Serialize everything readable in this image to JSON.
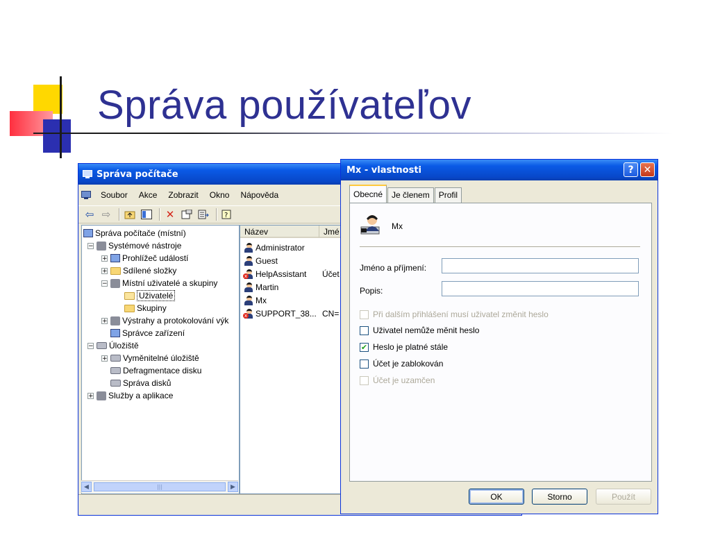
{
  "slide": {
    "title": "Správa používateľov"
  },
  "mmc": {
    "title": "Správa počítače",
    "menu": [
      "Soubor",
      "Akce",
      "Zobrazit",
      "Okno",
      "Nápověda"
    ],
    "tree": [
      {
        "label": "Správa počítače (místní)",
        "level": 0,
        "expander": "",
        "icon": "computer-icon"
      },
      {
        "label": "Systémové nástroje",
        "level": 1,
        "expander": "−",
        "icon": "tools-icon"
      },
      {
        "label": "Prohlížeč událostí",
        "level": 2,
        "expander": "+",
        "icon": "event-viewer-icon"
      },
      {
        "label": "Sdílené složky",
        "level": 2,
        "expander": "+",
        "icon": "shared-folder-icon"
      },
      {
        "label": "Místní uživatelé a skupiny",
        "level": 2,
        "expander": "−",
        "icon": "users-icon"
      },
      {
        "label": "Uživatelé",
        "level": 3,
        "expander": "",
        "icon": "folder-open-icon",
        "selected": true
      },
      {
        "label": "Skupiny",
        "level": 3,
        "expander": "",
        "icon": "folder-icon"
      },
      {
        "label": "Výstrahy a protokolování výk",
        "level": 2,
        "expander": "+",
        "icon": "alerts-icon"
      },
      {
        "label": "Správce zařízení",
        "level": 2,
        "expander": "",
        "icon": "device-manager-icon"
      },
      {
        "label": "Úložiště",
        "level": 1,
        "expander": "−",
        "icon": "storage-icon"
      },
      {
        "label": "Vyměnitelné úložiště",
        "level": 2,
        "expander": "+",
        "icon": "removable-storage-icon"
      },
      {
        "label": "Defragmentace disku",
        "level": 2,
        "expander": "",
        "icon": "defrag-icon"
      },
      {
        "label": "Správa disků",
        "level": 2,
        "expander": "",
        "icon": "disk-management-icon"
      },
      {
        "label": "Služby a aplikace",
        "level": 1,
        "expander": "+",
        "icon": "services-icon"
      }
    ],
    "scroll_glyph": "|||",
    "list_headers": [
      "Název",
      "Jmé"
    ],
    "users": [
      {
        "name": "Administrator",
        "full": "",
        "disabled": false
      },
      {
        "name": "Guest",
        "full": "",
        "disabled": false
      },
      {
        "name": "HelpAssistant",
        "full": "Účet",
        "disabled": true
      },
      {
        "name": "Martin",
        "full": "",
        "disabled": false
      },
      {
        "name": "Mx",
        "full": "",
        "disabled": false
      },
      {
        "name": "SUPPORT_38...",
        "full": "CN=",
        "disabled": true
      }
    ]
  },
  "dialog": {
    "title": "Mx - vlastnosti",
    "help_glyph": "?",
    "close_glyph": "✕",
    "tabs": [
      "Obecné",
      "Je členem",
      "Profil"
    ],
    "active_tab": "Obecné",
    "username": "Mx",
    "full_name_label": "Jméno a příjmení:",
    "full_name_value": "",
    "description_label": "Popis:",
    "description_value": "",
    "options": [
      {
        "label": "Při dalším přihlášení musí uživatel změnit heslo",
        "checked": false,
        "enabled": false
      },
      {
        "label": "Uživatel nemůže měnit heslo",
        "checked": false,
        "enabled": true
      },
      {
        "label": "Heslo je platné stále",
        "checked": true,
        "enabled": true
      },
      {
        "label": "Účet je zablokován",
        "checked": false,
        "enabled": true
      },
      {
        "label": "Účet je uzamčen",
        "checked": false,
        "enabled": false
      }
    ],
    "buttons": {
      "ok": "OK",
      "cancel": "Storno",
      "apply": "Použít"
    },
    "check_glyph": "✔"
  },
  "colors": {
    "title_blue": "#2e3192",
    "xp_title": "#0a5ae6",
    "accent_yellow": "#ffd800",
    "accent_red": "#ff2f3f"
  }
}
